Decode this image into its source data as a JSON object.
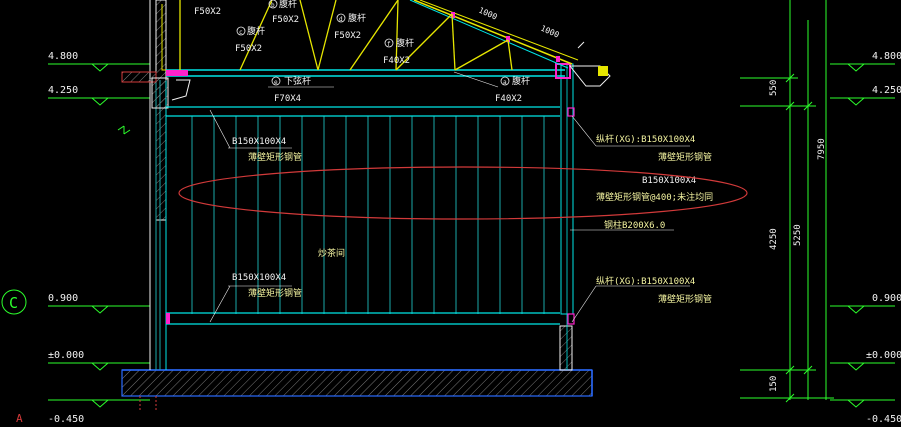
{
  "colors": {
    "background": "#000000",
    "level_green": "#2cff2c",
    "cyan": "#00e6e6",
    "white": "#f2f2f2",
    "yellow": "#e6e600",
    "magenta": "#ff22cc",
    "red": "#d23a3a",
    "blue": "#2a6bff",
    "text_yellow": "#f3f3a0",
    "teal_post": "#1aa8a8"
  },
  "levels_left": [
    "4.800",
    "4.250",
    "0.900",
    "±0.000",
    "-0.450"
  ],
  "levels_right": [
    "4.800",
    "4.250",
    "0.900",
    "±0.000",
    "-0.450"
  ],
  "grid_bubble": "C",
  "corner_mark": "A",
  "truss_labels": {
    "f50x2_top": "F50X2",
    "web_b_circle": "b",
    "web_b_label": "腹杆",
    "web_b_size": "F50X2",
    "web_c_circle": "c",
    "web_c_label": "腹杆",
    "web_c_size": "F50X2",
    "web_d_circle": "d",
    "web_d_label": "腹杆",
    "web_d_size": "F50X2",
    "web_f_circle": "f",
    "web_f_label": "腹杆",
    "web_f_size": "F40X2",
    "bottom_chord_circle": "e",
    "bottom_chord_label": "下弦杆",
    "bottom_chord_size": "F70X4",
    "web_a_circle": "a",
    "web_a_label": "腹杆",
    "web_a_size": "F40X2",
    "roof_dim1": "1000",
    "roof_dim2": "1000"
  },
  "members": {
    "top_left_spec": "B150X100X4",
    "top_left_desc": "薄壁矩形钢管",
    "bottom_left_spec": "B150X100X4",
    "bottom_left_desc": "薄壁矩形钢管",
    "top_right_spec": "纵杆(XG):B150X100X4",
    "top_right_desc": "薄壁矩形钢管",
    "mid_right_spec": "B150X100X4",
    "mid_right_desc": "薄壁矩形钢管@400;未注均同",
    "column_spec": "钢柱B200X6.0",
    "bottom_right_spec": "纵杆(XG):B150X100X4",
    "bottom_right_desc": "薄壁矩形钢管",
    "room_name": "炒茶间"
  },
  "dimensions": {
    "d550": "550",
    "d4250": "4250",
    "d150": "150",
    "d5250": "5250",
    "d7950": "7950"
  }
}
